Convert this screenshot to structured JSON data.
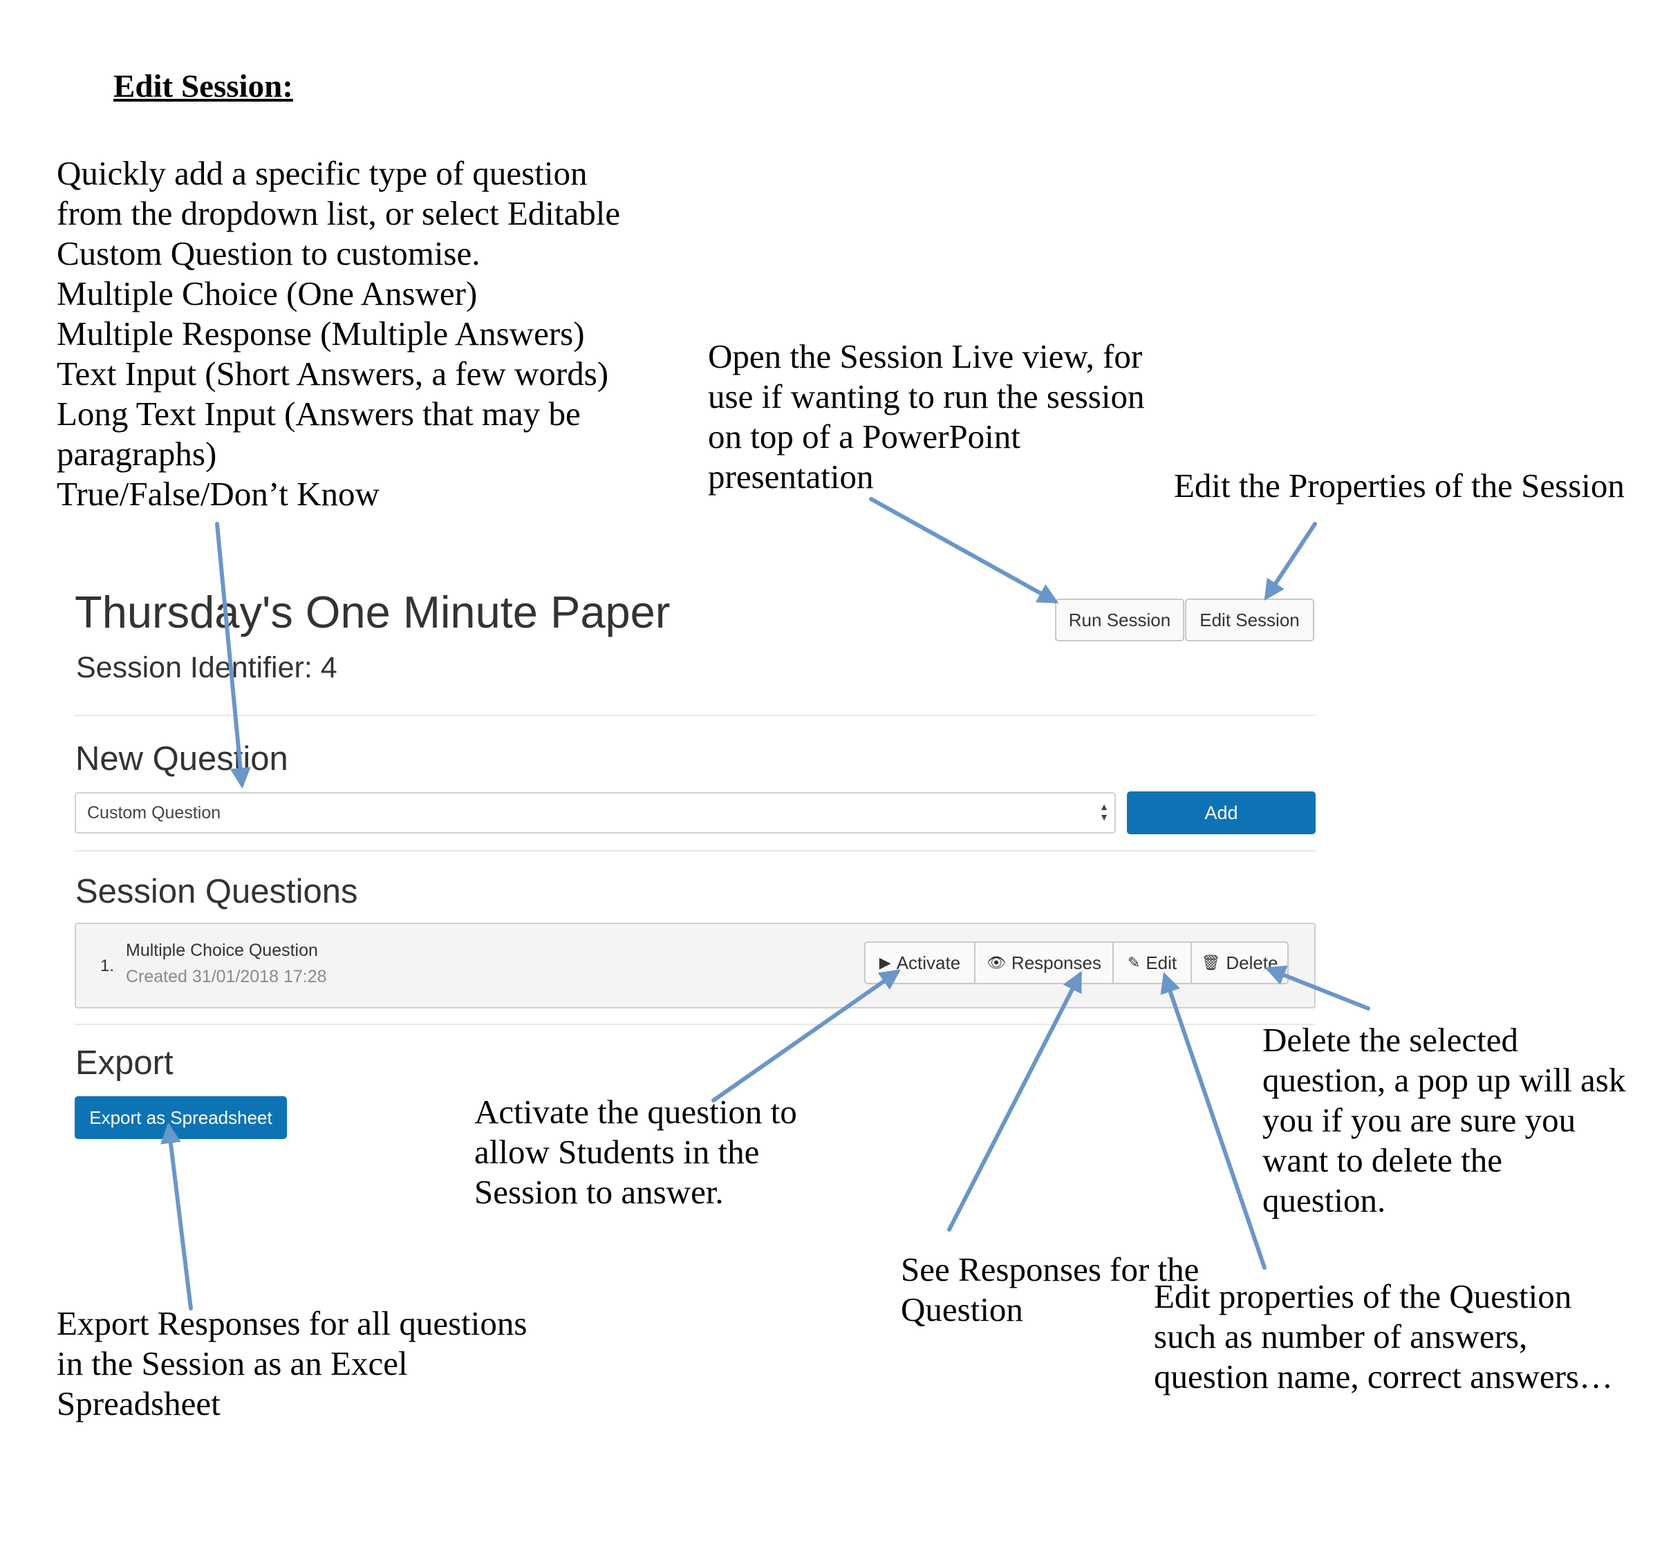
{
  "doc": {
    "heading": "Edit Session:"
  },
  "notes": {
    "new_question": [
      "Quickly add a specific type of question",
      "from the dropdown list, or select Editable",
      "Custom Question to customise.",
      "Multiple Choice (One Answer)",
      "Multiple Response (Multiple Answers)",
      "Text Input (Short Answers, a few words)",
      "Long Text Input (Answers that may be",
      "paragraphs)",
      "True/False/Don’t Know"
    ],
    "run_session": [
      "Open the Session Live view, for",
      "use if wanting to run the session",
      "on top of a PowerPoint",
      "presentation"
    ],
    "edit_session": [
      "Edit the Properties of the Session"
    ],
    "activate": [
      "Activate the question to",
      "allow Students in the",
      "Session to answer."
    ],
    "delete": [
      "Delete the selected",
      "question, a pop up will ask",
      "you if you are sure you",
      "want to delete the",
      "question."
    ],
    "responses": [
      "See Responses for the",
      "Question"
    ],
    "edit": [
      "Edit properties of the Question",
      "such as number of answers,",
      "question name, correct answers…"
    ],
    "export": [
      "Export Responses for all questions",
      "in the Session as an Excel",
      "Spreadsheet"
    ]
  },
  "ui": {
    "session_title": "Thursday's One Minute Paper",
    "session_identifier": "Session Identifier: 4",
    "header_buttons": {
      "run": "Run Session",
      "edit": "Edit Session"
    },
    "new_question": {
      "heading": "New Question",
      "select_value": "Custom Question",
      "add_label": "Add"
    },
    "session_questions": {
      "heading": "Session Questions",
      "items": [
        {
          "number": "1.",
          "name": "Multiple Choice Question",
          "created": "Created 31/01/2018 17:28",
          "actions": {
            "activate": "Activate",
            "responses": "Responses",
            "edit": "Edit",
            "delete": "Delete"
          }
        }
      ]
    },
    "export": {
      "heading": "Export",
      "button": "Export as Spreadsheet"
    }
  },
  "icons": {
    "activate": "play-icon",
    "responses": "eye-icon",
    "edit": "pencil-icon",
    "delete": "trash-icon",
    "select": "select-arrows-icon"
  },
  "colors": {
    "primary_button": "#0e73b5",
    "arrow": "#6a96c8",
    "text": "#333333"
  }
}
